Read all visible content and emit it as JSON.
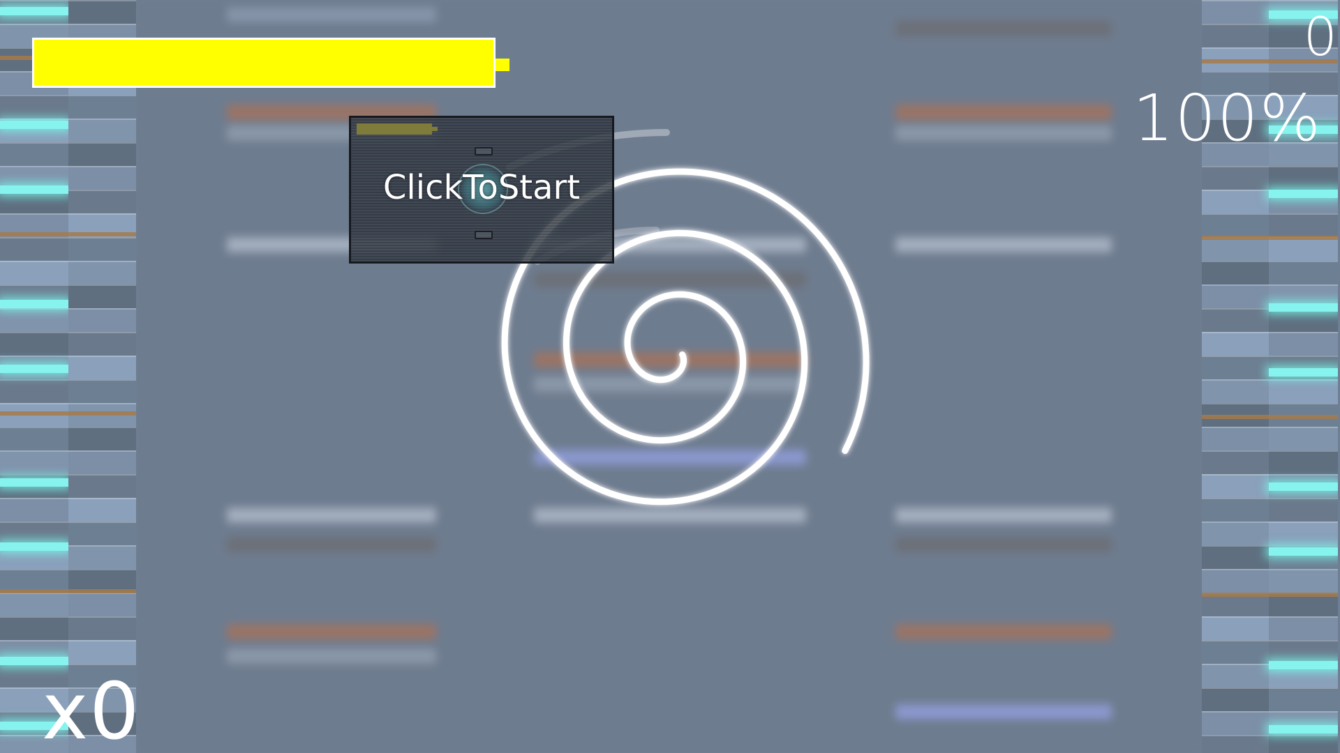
{
  "hud": {
    "score": "0",
    "accuracy": "100%",
    "combo": "x0",
    "health_fraction": 1.0
  },
  "start_panel": {
    "label": "ClickToStart"
  },
  "colors": {
    "health": "#ffff00",
    "note_glow": "#86f3ee",
    "background": "#6f7f93",
    "panel": "#373e48"
  },
  "icons": [
    "target-icon",
    "spiral-cursor-trail"
  ]
}
